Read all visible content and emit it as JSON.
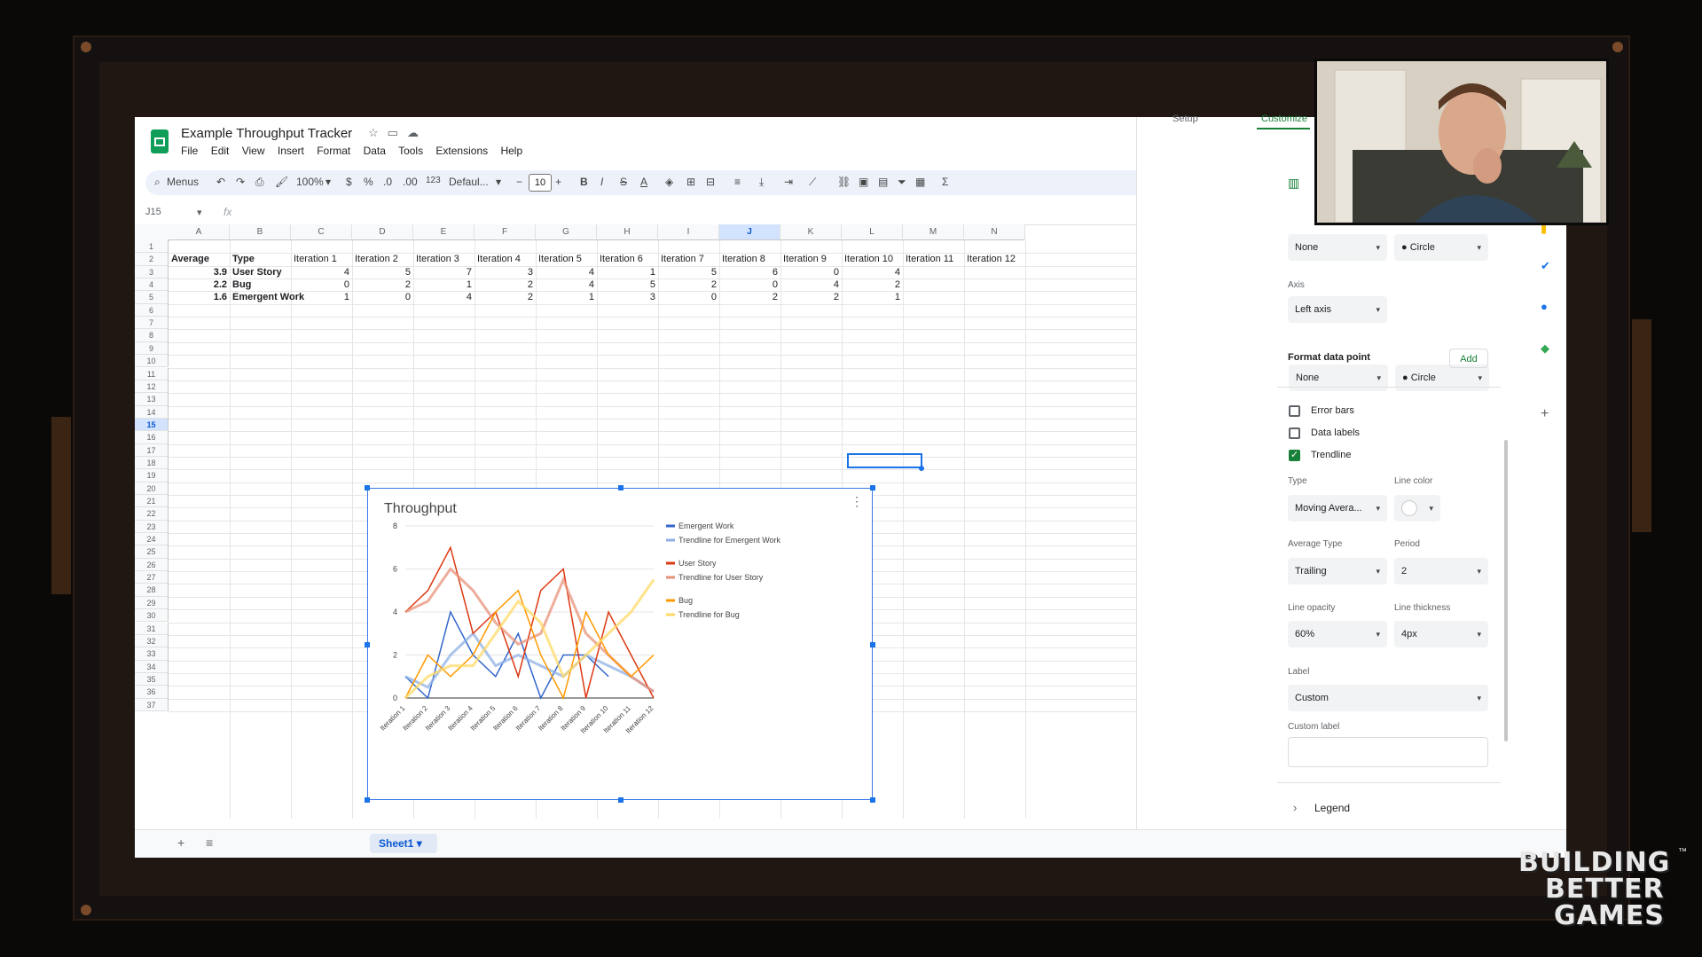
{
  "doc": {
    "title": "Example Throughput Tracker",
    "menus": [
      "File",
      "Edit",
      "View",
      "Insert",
      "Format",
      "Data",
      "Tools",
      "Extensions",
      "Help"
    ]
  },
  "toolbar": {
    "search_label": "Menus",
    "zoom": "100%",
    "currency": "$",
    "percent": "%",
    "dec_decrease": ".0",
    "dec_increase": ".00",
    "number_format": "123",
    "font": "Defaul...",
    "font_size": "10",
    "minus": "−",
    "plus": "+",
    "bold": "B",
    "italic": "I",
    "strike": "S",
    "text_color": "A",
    "sum": "Σ"
  },
  "formula_bar": {
    "name_box": "J15",
    "fx": "fx"
  },
  "grid": {
    "columns": [
      "A",
      "B",
      "C",
      "D",
      "E",
      "F",
      "G",
      "H",
      "I",
      "J",
      "K",
      "L",
      "M",
      "N"
    ],
    "selected_column": "J",
    "selected_row": "15",
    "rows": [
      "1",
      "2",
      "3",
      "4",
      "5",
      "6",
      "7",
      "8",
      "9",
      "10",
      "11",
      "12",
      "13",
      "14",
      "15",
      "16",
      "17",
      "18",
      "19",
      "20",
      "21",
      "22",
      "23",
      "24",
      "25",
      "26",
      "27",
      "28",
      "29",
      "30",
      "31",
      "32",
      "33",
      "34",
      "35",
      "36",
      "37"
    ],
    "header_row": [
      "Average",
      "Type",
      "Iteration 1",
      "Iteration 2",
      "Iteration 3",
      "Iteration 4",
      "Iteration 5",
      "Iteration 6",
      "Iteration 7",
      "Iteration 8",
      "Iteration 9",
      "Iteration 10",
      "Iteration 11",
      "Iteration 12"
    ],
    "data_rows": [
      {
        "avg": "3.9",
        "type": "User Story",
        "values": [
          "4",
          "5",
          "7",
          "3",
          "4",
          "1",
          "5",
          "6",
          "0",
          "4"
        ]
      },
      {
        "avg": "2.2",
        "type": "Bug",
        "values": [
          "0",
          "2",
          "1",
          "2",
          "4",
          "5",
          "2",
          "0",
          "4",
          "2"
        ]
      },
      {
        "avg": "1.6",
        "type": "Emergent Work",
        "values": [
          "1",
          "0",
          "4",
          "2",
          "1",
          "3",
          "0",
          "2",
          "2",
          "1"
        ]
      }
    ]
  },
  "chart_data": {
    "type": "line",
    "title": "Throughput",
    "categories": [
      "Iteration 1",
      "Iteration 2",
      "Iteration 3",
      "Iteration 4",
      "Iteration 5",
      "Iteration 6",
      "Iteration 7",
      "Iteration 8",
      "Iteration 9",
      "Iteration 10",
      "Iteration 11",
      "Iteration 12"
    ],
    "y_ticks": [
      "0",
      "2",
      "4",
      "6",
      "8"
    ],
    "ylim": [
      0,
      8
    ],
    "legend_position": "right",
    "series": [
      {
        "name": "Emergent Work",
        "color": "#3366cc",
        "values": [
          1,
          0,
          4,
          2,
          1,
          3,
          0,
          2,
          2,
          1
        ]
      },
      {
        "name": "Trendline for Emergent Work",
        "color": "#8fb0e6",
        "values": [
          1,
          0.5,
          2,
          3,
          1.5,
          2,
          1.5,
          1,
          2,
          1.5,
          1,
          0.3
        ]
      },
      {
        "name": "User Story",
        "color": "#dc3912",
        "values": [
          4,
          5,
          7,
          3,
          4,
          1,
          5,
          6,
          0,
          4,
          2,
          0
        ]
      },
      {
        "name": "Trendline for User Story",
        "color": "#e8917a",
        "values": [
          4,
          4.5,
          6,
          5,
          3.5,
          2.5,
          3,
          5.5,
          3,
          2,
          1,
          0.3
        ]
      },
      {
        "name": "Bug",
        "color": "#ff9900",
        "values": [
          0,
          2,
          1,
          2,
          4,
          5,
          2,
          0,
          4,
          2,
          1,
          2
        ]
      },
      {
        "name": "Trendline for Bug",
        "color": "#ffd966",
        "values": [
          0,
          1,
          1.5,
          1.5,
          3,
          4.5,
          3.5,
          1,
          2,
          3,
          4,
          5.5
        ]
      }
    ]
  },
  "panel": {
    "tabs": [
      "Setup",
      "Customize"
    ],
    "point_size": "None",
    "point_shape": "Circle",
    "axis_label": "Axis",
    "axis_value": "Left axis",
    "format_data_point": "Format data point",
    "add": "Add",
    "error_bars": "Error bars",
    "data_labels": "Data labels",
    "trendline": "Trendline",
    "type_label": "Type",
    "type_value": "Moving Avera...",
    "line_color_label": "Line color",
    "avg_type_label": "Average Type",
    "avg_type_value": "Trailing",
    "period_label": "Period",
    "period_value": "2",
    "opacity_label": "Line opacity",
    "opacity_value": "60%",
    "thickness_label": "Line thickness",
    "thickness_value": "4px",
    "label_label": "Label",
    "label_value": "Custom",
    "custom_label": "Custom label",
    "legend": "Legend"
  },
  "tabs": {
    "sheet1": "Sheet1"
  },
  "brand": {
    "line1": "BUILDING",
    "line2": "BETTER",
    "line3": "GAMES",
    "tm": "™"
  },
  "colors": {
    "sheets_green": "#0f9d58",
    "selection_blue": "#1a73e8",
    "checkbox_green": "#188038"
  }
}
